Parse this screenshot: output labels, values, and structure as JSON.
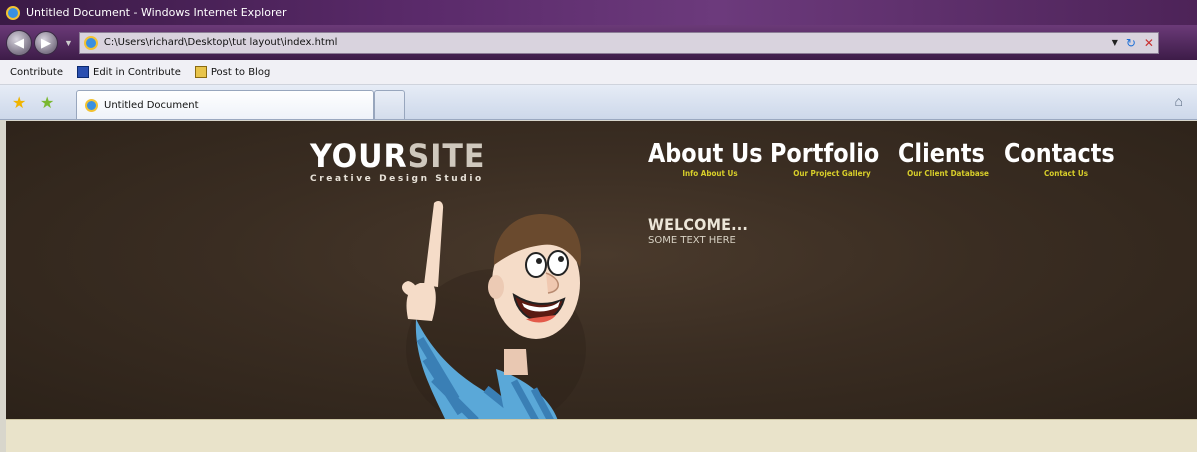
{
  "window": {
    "title": "Untitled Document - Windows Internet Explorer"
  },
  "address_bar": {
    "url": "C:\\Users\\richard\\Desktop\\tut layout\\index.html"
  },
  "contribute_toolbar": {
    "contribute_label": "Contribute",
    "edit_label": "Edit in Contribute",
    "post_label": "Post to Blog"
  },
  "tabs": [
    {
      "label": "Untitled Document"
    }
  ],
  "site": {
    "logo_main_a": "YOUR",
    "logo_main_b": "SITE",
    "logo_sub": "Creative Design Studio",
    "nav": [
      {
        "label": "About Us",
        "sub": "Info About Us"
      },
      {
        "label": "Portfolio",
        "sub": "Our Project Gallery"
      },
      {
        "label": "Clients",
        "sub": "Our Client Database"
      },
      {
        "label": "Contacts",
        "sub": "Contact Us"
      }
    ],
    "welcome_heading": "WELCOME...",
    "welcome_text": "SOME TEXT HERE"
  },
  "colors": {
    "header_bg": "#3a2d22",
    "nav_sub": "#d8cf2a",
    "title_bar": "#5a2a6a",
    "footer_strip": "#e9e3ca"
  }
}
